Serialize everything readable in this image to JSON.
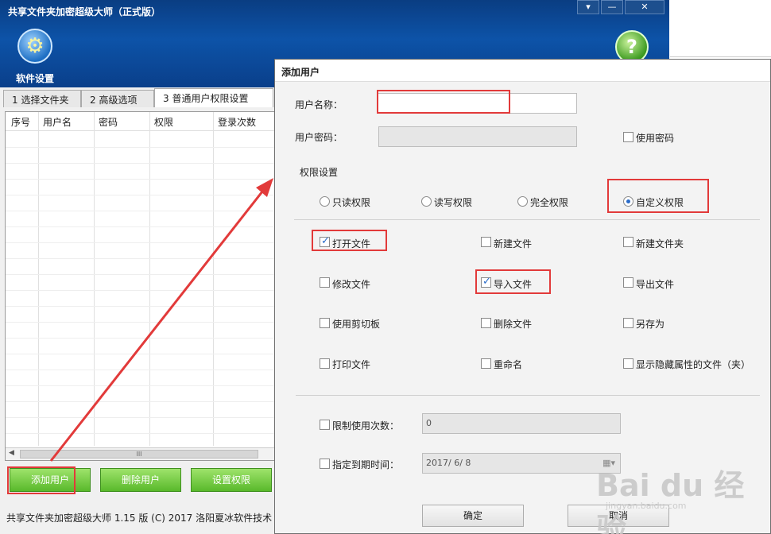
{
  "main_window": {
    "title": "共享文件夹加密超级大师（正式版）",
    "controls": {
      "menu": "▾",
      "minimize": "—",
      "close": "✕"
    },
    "toolbar": {
      "settings_label": "软件设置",
      "gear_icon": "⚙",
      "help_icon": "?"
    },
    "tabs": [
      "1 选择文件夹",
      "2 高级选项",
      "3 普通用户权限设置"
    ],
    "table": {
      "headers": [
        "序号",
        "用户名",
        "密码",
        "权限",
        "登录次数"
      ],
      "scroll_thumb": "III"
    },
    "buttons": {
      "add_user": "添加用户",
      "delete_user": "删除用户",
      "set_permission": "设置权限"
    },
    "status": "共享文件夹加密超级大师 1.15 版  (C)  2017 洛阳夏冰软件技术"
  },
  "dialog": {
    "title": "添加用户",
    "username_label": "用户名称：",
    "username_value": "",
    "password_label": "用户密码：",
    "password_value": "",
    "use_password_label": "使用密码",
    "permission_group_label": "权限设置",
    "permission_levels": [
      {
        "label": "只读权限",
        "selected": false
      },
      {
        "label": "读写权限",
        "selected": false
      },
      {
        "label": "完全权限",
        "selected": false
      },
      {
        "label": "自定义权限",
        "selected": true
      }
    ],
    "custom_permissions": [
      {
        "label": "打开文件",
        "checked": true
      },
      {
        "label": "新建文件",
        "checked": false
      },
      {
        "label": "新建文件夹",
        "checked": false
      },
      {
        "label": "修改文件",
        "checked": false
      },
      {
        "label": "导入文件",
        "checked": true
      },
      {
        "label": "导出文件",
        "checked": false
      },
      {
        "label": "使用剪切板",
        "checked": false
      },
      {
        "label": "删除文件",
        "checked": false
      },
      {
        "label": "另存为",
        "checked": false
      },
      {
        "label": "打印文件",
        "checked": false
      },
      {
        "label": "重命名",
        "checked": false
      },
      {
        "label": "显示隐藏属性的文件（夹）",
        "checked": false
      }
    ],
    "limit_count_label": "限制使用次数：",
    "limit_count_value": "0",
    "expire_label": "指定到期时间：",
    "expire_value": "2017/  6/  8",
    "ok_label": "确定",
    "cancel_label": "取消"
  },
  "colors": {
    "annotation_red": "#e23a3a",
    "title_blue": "#0d53a8",
    "button_green": "#59b92b"
  },
  "watermark": {
    "brand": "Bai du 经验",
    "url": "jingyan.baidu.com"
  }
}
